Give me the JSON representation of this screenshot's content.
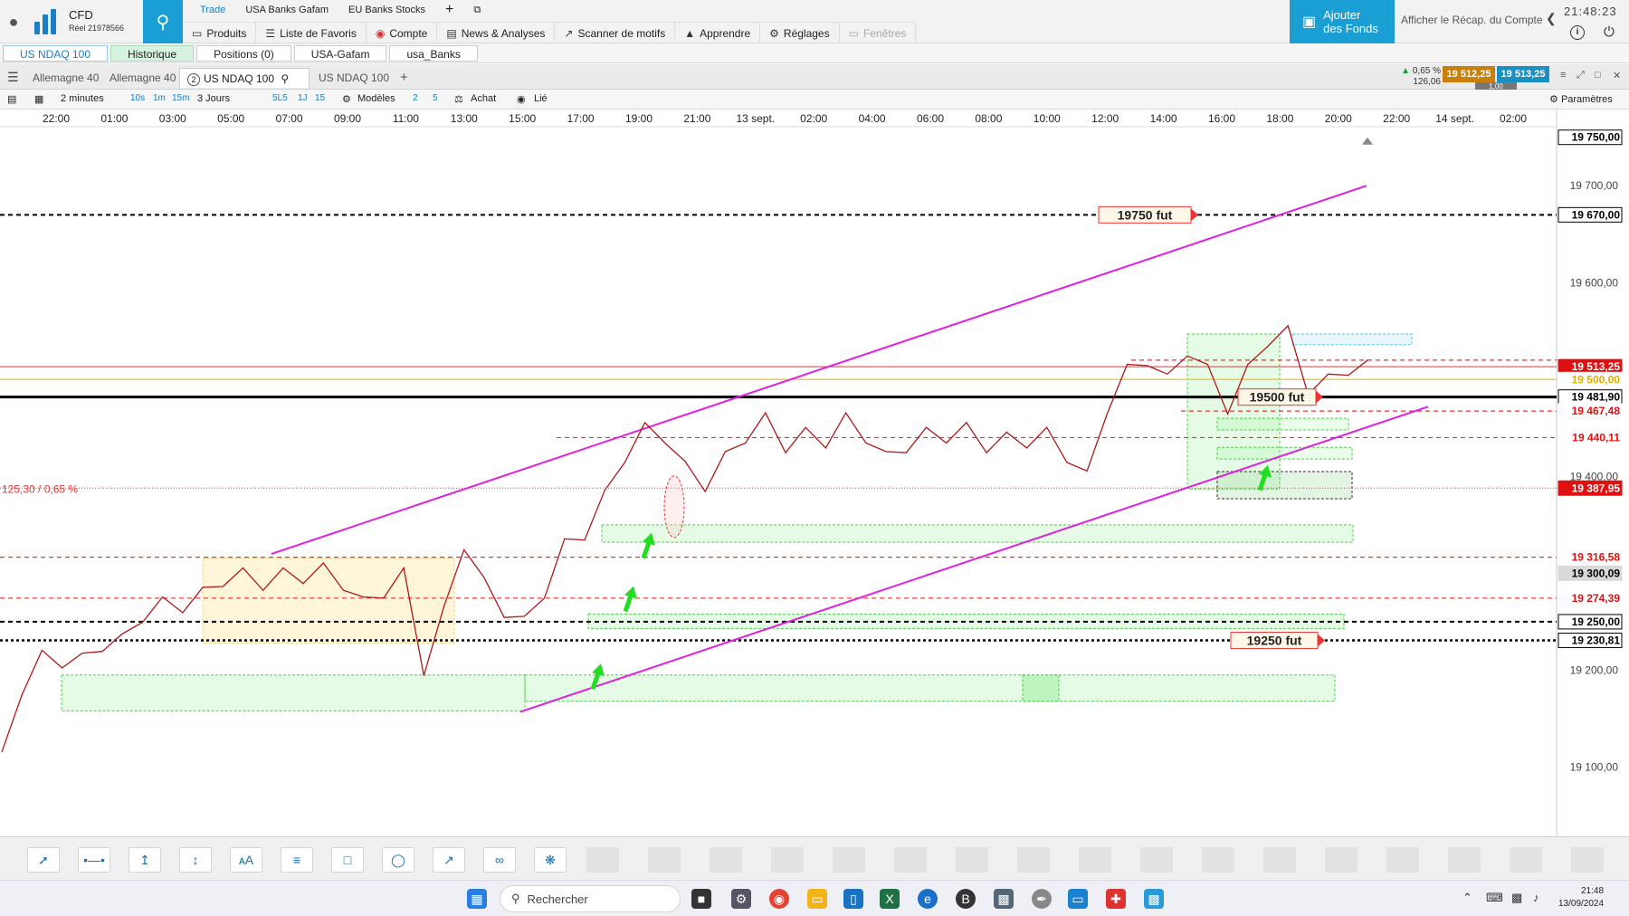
{
  "account": {
    "type": "CFD",
    "number": "Réel 21978566"
  },
  "workspace_tabs": [
    "Trade",
    "USA Banks Gafam",
    "EU Banks Stocks"
  ],
  "add_tab": "+",
  "menu": [
    {
      "label": "Produits",
      "icon": "product-icon"
    },
    {
      "label": "Liste de Favoris",
      "icon": "list-icon"
    },
    {
      "label": "Compte",
      "icon": "account-icon"
    },
    {
      "label": "News & Analyses",
      "icon": "news-icon"
    },
    {
      "label": "Scanner de motifs",
      "icon": "scanner-icon"
    },
    {
      "label": "Apprendre",
      "icon": "learn-icon"
    },
    {
      "label": "Réglages",
      "icon": "gear-icon"
    },
    {
      "label": "Fenêtres",
      "icon": "window-icon"
    }
  ],
  "fund_button": {
    "line1": "Ajouter",
    "line2": "des Fonds"
  },
  "recap_link": "Afficher le Récap. du Compte",
  "clock": "21:48:23",
  "second_tabs": [
    "US NDAQ 100",
    "Historique",
    "Positions (0)",
    "USA-Gafam",
    "usa_Banks"
  ],
  "chart_tabs": [
    "Allemagne 40",
    "Allemagne 40",
    "US NDAQ 100",
    "US NDAQ 100"
  ],
  "chart_tab_badge": "2",
  "quote": {
    "change_pct": "0,65 %",
    "change_abs": "126,06",
    "bid": "19 512,25",
    "ask": "19 513,25",
    "qty": "1,00"
  },
  "toolbar": {
    "interval": "2 minutes",
    "i10s": "10s",
    "i1m": "1m",
    "i15m": "15m",
    "range": "3 Jours",
    "r5ls": "5L5",
    "r1j": "1J",
    "r15": "15",
    "templates": "Modèles",
    "n2": "2",
    "n5": "5",
    "buy": "Achat",
    "linked": "Lié",
    "params": "Paramètres"
  },
  "chart_data": {
    "type": "line",
    "title": "",
    "x_ticks": [
      "22:00",
      "01:00",
      "03:00",
      "05:00",
      "07:00",
      "09:00",
      "11:00",
      "13:00",
      "15:00",
      "17:00",
      "19:00",
      "21:00",
      "13 sept.",
      "02:00",
      "04:00",
      "06:00",
      "08:00",
      "10:00",
      "12:00",
      "14:00",
      "16:00",
      "18:00",
      "20:00",
      "22:00",
      "14 sept.",
      "02:00"
    ],
    "y_ticks": [
      19100,
      19200,
      19300,
      19400,
      19500,
      19600,
      19700,
      19750
    ],
    "ylim": [
      19050,
      19760
    ],
    "y_tick_labels": [
      "19 100,00",
      "19 200,00",
      "19 300,00",
      "19 400,00",
      "19 500,00",
      "19 600,00",
      "19 700,00",
      "19 750,00"
    ],
    "price_tags": [
      {
        "label": "19 670,00",
        "value": 19670,
        "style": "black-outline"
      },
      {
        "label": "19 513,25",
        "value": 19513.25,
        "style": "red-fill"
      },
      {
        "label": "19 500,00",
        "value": 19500,
        "style": "yellow"
      },
      {
        "label": "19 481,90",
        "value": 19481.9,
        "style": "black-outline"
      },
      {
        "label": "19 467,48",
        "value": 19467.48,
        "style": "red-text"
      },
      {
        "label": "19 440,11",
        "value": 19440.11,
        "style": "red-text"
      },
      {
        "label": "19 387,95",
        "value": 19387.95,
        "style": "red-fill"
      },
      {
        "label": "19 316,58",
        "value": 19316.58,
        "style": "red-text"
      },
      {
        "label": "19 300,09",
        "value": 19300.09,
        "style": "gray-fill"
      },
      {
        "label": "19 274,39",
        "value": 19274.39,
        "style": "red-text"
      },
      {
        "label": "19 250,00",
        "value": 19250,
        "style": "black-outline"
      },
      {
        "label": "19 230,81",
        "value": 19230.81,
        "style": "black-outline"
      }
    ],
    "annotations": [
      {
        "text": "19750  fut",
        "value": 19670
      },
      {
        "text": "19500 fut",
        "value": 19481.9
      },
      {
        "text": "19250  fut",
        "value": 19230.81
      },
      {
        "text": "125,30 / 0,65 %",
        "value": 19387.95
      }
    ],
    "series": [
      {
        "values": [
          19110,
          19180,
          19215,
          19208,
          19212,
          19225,
          19232,
          19255,
          19270,
          19265,
          19280,
          19292,
          19300,
          19288,
          19300,
          19295,
          19305,
          19288,
          19270,
          19280,
          19300,
          19200,
          19260,
          19330,
          19290,
          19260,
          19250,
          19280,
          19330,
          19340,
          19380,
          19420,
          19450,
          19440,
          19410,
          19390,
          19420,
          19440,
          19460,
          19430,
          19445,
          19435,
          19460,
          19440,
          19420,
          19430,
          19445,
          19440,
          19450,
          19430,
          19440,
          19435,
          19445,
          19420,
          19400,
          19470,
          19510,
          19520,
          19500,
          19530,
          19510,
          19470,
          19510,
          19540,
          19550,
          19490,
          19500,
          19510,
          19515
        ]
      }
    ]
  }
}
